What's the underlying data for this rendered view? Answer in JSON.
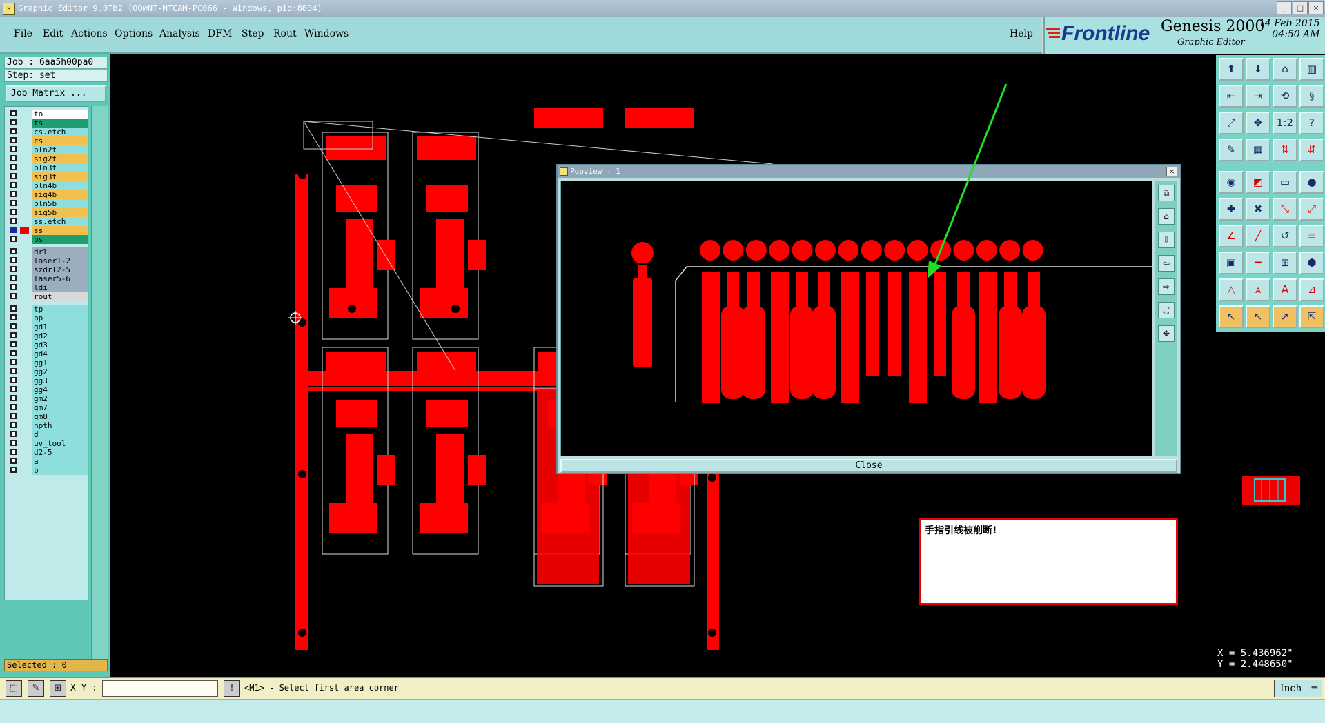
{
  "window": {
    "title": "Graphic Editor 9.0Tb2 (OO@NT-MTCAM-PC066 - Windows, pid:8804)",
    "controls": [
      "_",
      "□",
      "×"
    ]
  },
  "menu": {
    "items": [
      "File",
      "Edit",
      "Actions",
      "Options",
      "Analysis",
      "DFM",
      "Step",
      "Rout",
      "Windows"
    ],
    "help": "Help"
  },
  "brand": {
    "logo": "Frontline",
    "product": "Genesis 2000",
    "subtitle": "Graphic Editor",
    "date": "14 Feb 2015",
    "time": "04:50 AM"
  },
  "job": {
    "job_line": "Job : 6aa5h00pa0",
    "step_line": "Step: set",
    "matrix_button": "Job Matrix ..."
  },
  "layers": [
    {
      "name": "to",
      "color": "#ffffff"
    },
    {
      "name": "ts",
      "color": "#1e9e6e"
    },
    {
      "name": "cs.etch",
      "color": "#8fdede"
    },
    {
      "name": "cs",
      "color": "#f2c04e"
    },
    {
      "name": "pln2t",
      "color": "#8fdede"
    },
    {
      "name": "sig2t",
      "color": "#f2c04e"
    },
    {
      "name": "pln3t",
      "color": "#8fdede"
    },
    {
      "name": "sig3t",
      "color": "#f2c04e"
    },
    {
      "name": "pln4b",
      "color": "#8fdede"
    },
    {
      "name": "sig4b",
      "color": "#f2c04e"
    },
    {
      "name": "pln5b",
      "color": "#8fdede"
    },
    {
      "name": "sig5b",
      "color": "#f2c04e"
    },
    {
      "name": "ss.etch",
      "color": "#8fdede"
    },
    {
      "name": "ss",
      "color": "#f2c04e",
      "active": true
    },
    {
      "name": "bs",
      "color": "#1e9e6e"
    },
    {
      "name": "drl",
      "color": "#9aaec0"
    },
    {
      "name": "laser1-2",
      "color": "#9aaec0"
    },
    {
      "name": "szdrl2-5",
      "color": "#9aaec0"
    },
    {
      "name": "laser5-6",
      "color": "#9aaec0"
    },
    {
      "name": "ldi",
      "color": "#9aaec0"
    },
    {
      "name": "rout",
      "color": "#d8d8d8"
    },
    {
      "name": "tp",
      "color": "#8fdede"
    },
    {
      "name": "bp",
      "color": "#8fdede"
    },
    {
      "name": "gd1",
      "color": "#8fdede"
    },
    {
      "name": "gd2",
      "color": "#8fdede"
    },
    {
      "name": "gd3",
      "color": "#8fdede"
    },
    {
      "name": "gd4",
      "color": "#8fdede"
    },
    {
      "name": "gg1",
      "color": "#8fdede"
    },
    {
      "name": "gg2",
      "color": "#8fdede"
    },
    {
      "name": "gg3",
      "color": "#8fdede"
    },
    {
      "name": "gg4",
      "color": "#8fdede"
    },
    {
      "name": "gm2",
      "color": "#8fdede"
    },
    {
      "name": "gm7",
      "color": "#8fdede"
    },
    {
      "name": "gm8",
      "color": "#8fdede"
    },
    {
      "name": "npth",
      "color": "#8fdede"
    },
    {
      "name": "d",
      "color": "#8fdede"
    },
    {
      "name": "uv_tool",
      "color": "#8fdede"
    },
    {
      "name": "d2-5",
      "color": "#8fdede"
    },
    {
      "name": "a",
      "color": "#8fdede"
    },
    {
      "name": "b",
      "color": "#8fdede"
    }
  ],
  "selected": "Selected : 0",
  "popup": {
    "title": "Popview - 1",
    "close_button": "Close",
    "close_x": "×"
  },
  "note": {
    "text": "手指引线被削断!"
  },
  "coords": {
    "x": "X = 5.436962\"",
    "y": "Y = 2.448650\""
  },
  "bottom": {
    "xy_label": "X Y :",
    "xy_value": "",
    "prompt": "<M1> - Select first area corner",
    "unit": "Inch"
  },
  "colors": {
    "copper": "#ff0000",
    "panel_teal": "#5fc7b5",
    "menu_bg": "#9fd9d9",
    "arrow": "#22dd22",
    "note_border": "#ee0000"
  }
}
